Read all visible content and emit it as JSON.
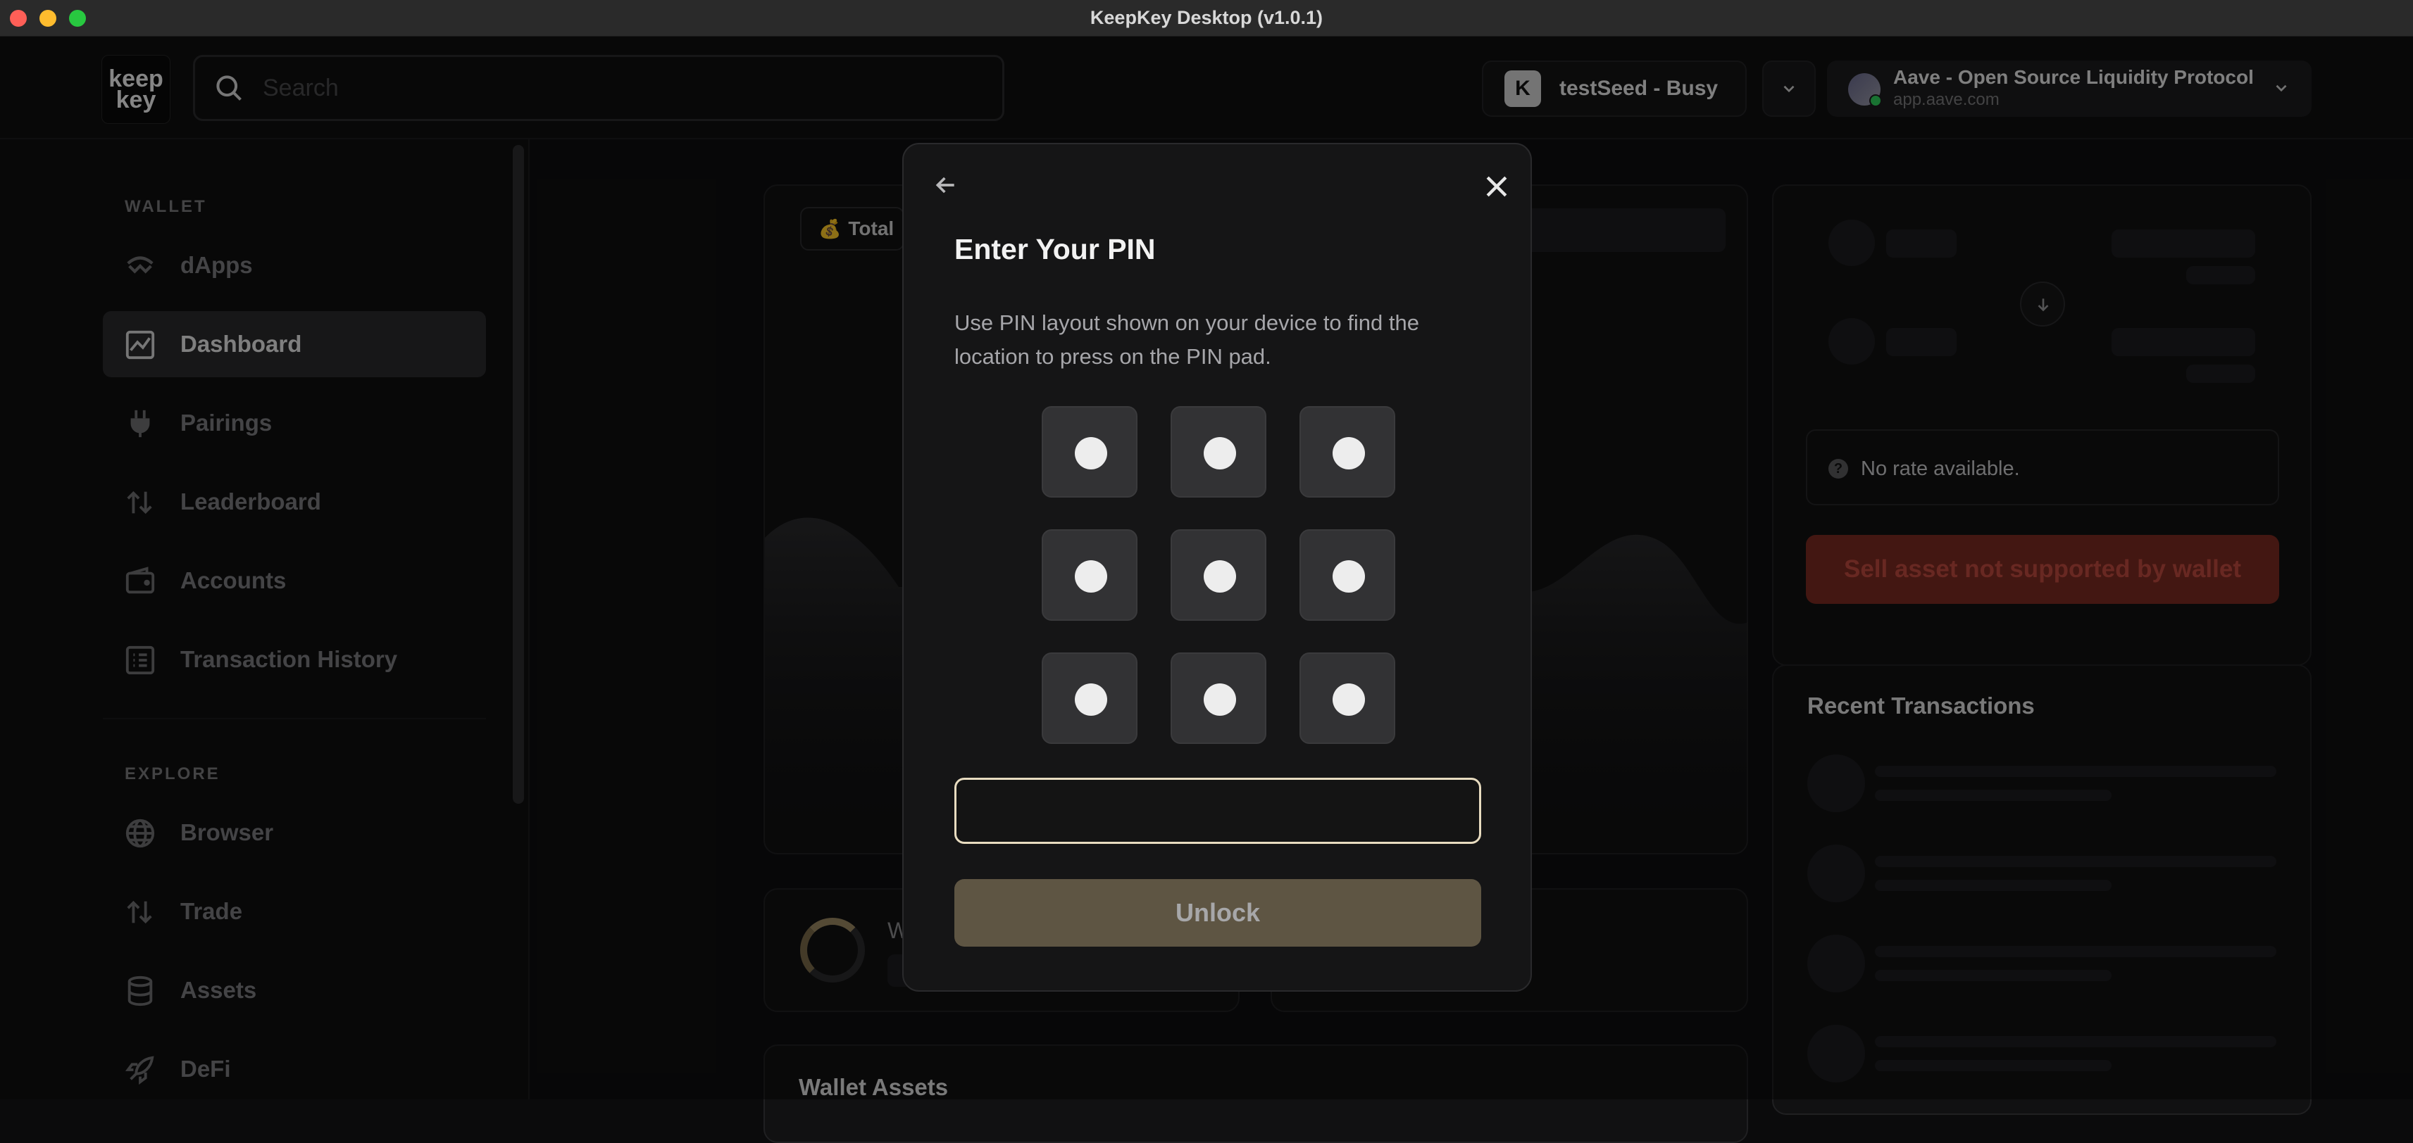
{
  "window": {
    "title": "KeepKey Desktop (v1.0.1)"
  },
  "header": {
    "logo_text": "keep key",
    "search_placeholder": "Search",
    "device_label": "testSeed - Busy",
    "device_icon": "K",
    "dapp": {
      "name": "Aave - Open Source Liquidity Protocol",
      "url": "app.aave.com"
    }
  },
  "sidebar": {
    "wallet_section": "WALLET",
    "explore_section": "EXPLORE",
    "wallet_items": [
      {
        "label": "dApps",
        "icon": "walletconnect-icon"
      },
      {
        "label": "Dashboard",
        "icon": "chart-icon",
        "active": true
      },
      {
        "label": "Pairings",
        "icon": "plug-icon"
      },
      {
        "label": "Leaderboard",
        "icon": "arrows-icon"
      },
      {
        "label": "Accounts",
        "icon": "wallet-icon"
      },
      {
        "label": "Transaction History",
        "icon": "list-icon"
      }
    ],
    "explore_items": [
      {
        "label": "Browser",
        "icon": "globe-icon"
      },
      {
        "label": "Trade",
        "icon": "arrows-icon"
      },
      {
        "label": "Assets",
        "icon": "database-icon"
      },
      {
        "label": "DeFi",
        "icon": "rocket-icon"
      }
    ]
  },
  "dashboard": {
    "total_label": "Total",
    "rate_text": "No rate available.",
    "sell_button": "Sell asset not supported by wallet",
    "recent_title": "Recent Transactions",
    "wallet_assets_title": "Wallet Assets",
    "wallet_card_initial": "W"
  },
  "modal": {
    "title": "Enter Your PIN",
    "description": "Use PIN layout shown on your device to find the location to press on the PIN pad.",
    "pin_value": "",
    "unlock_label": "Unlock"
  },
  "colors": {
    "accent": "#e8dcc0",
    "unlock_bg": "#5e5543",
    "sell_bg": "#7a2a22"
  }
}
